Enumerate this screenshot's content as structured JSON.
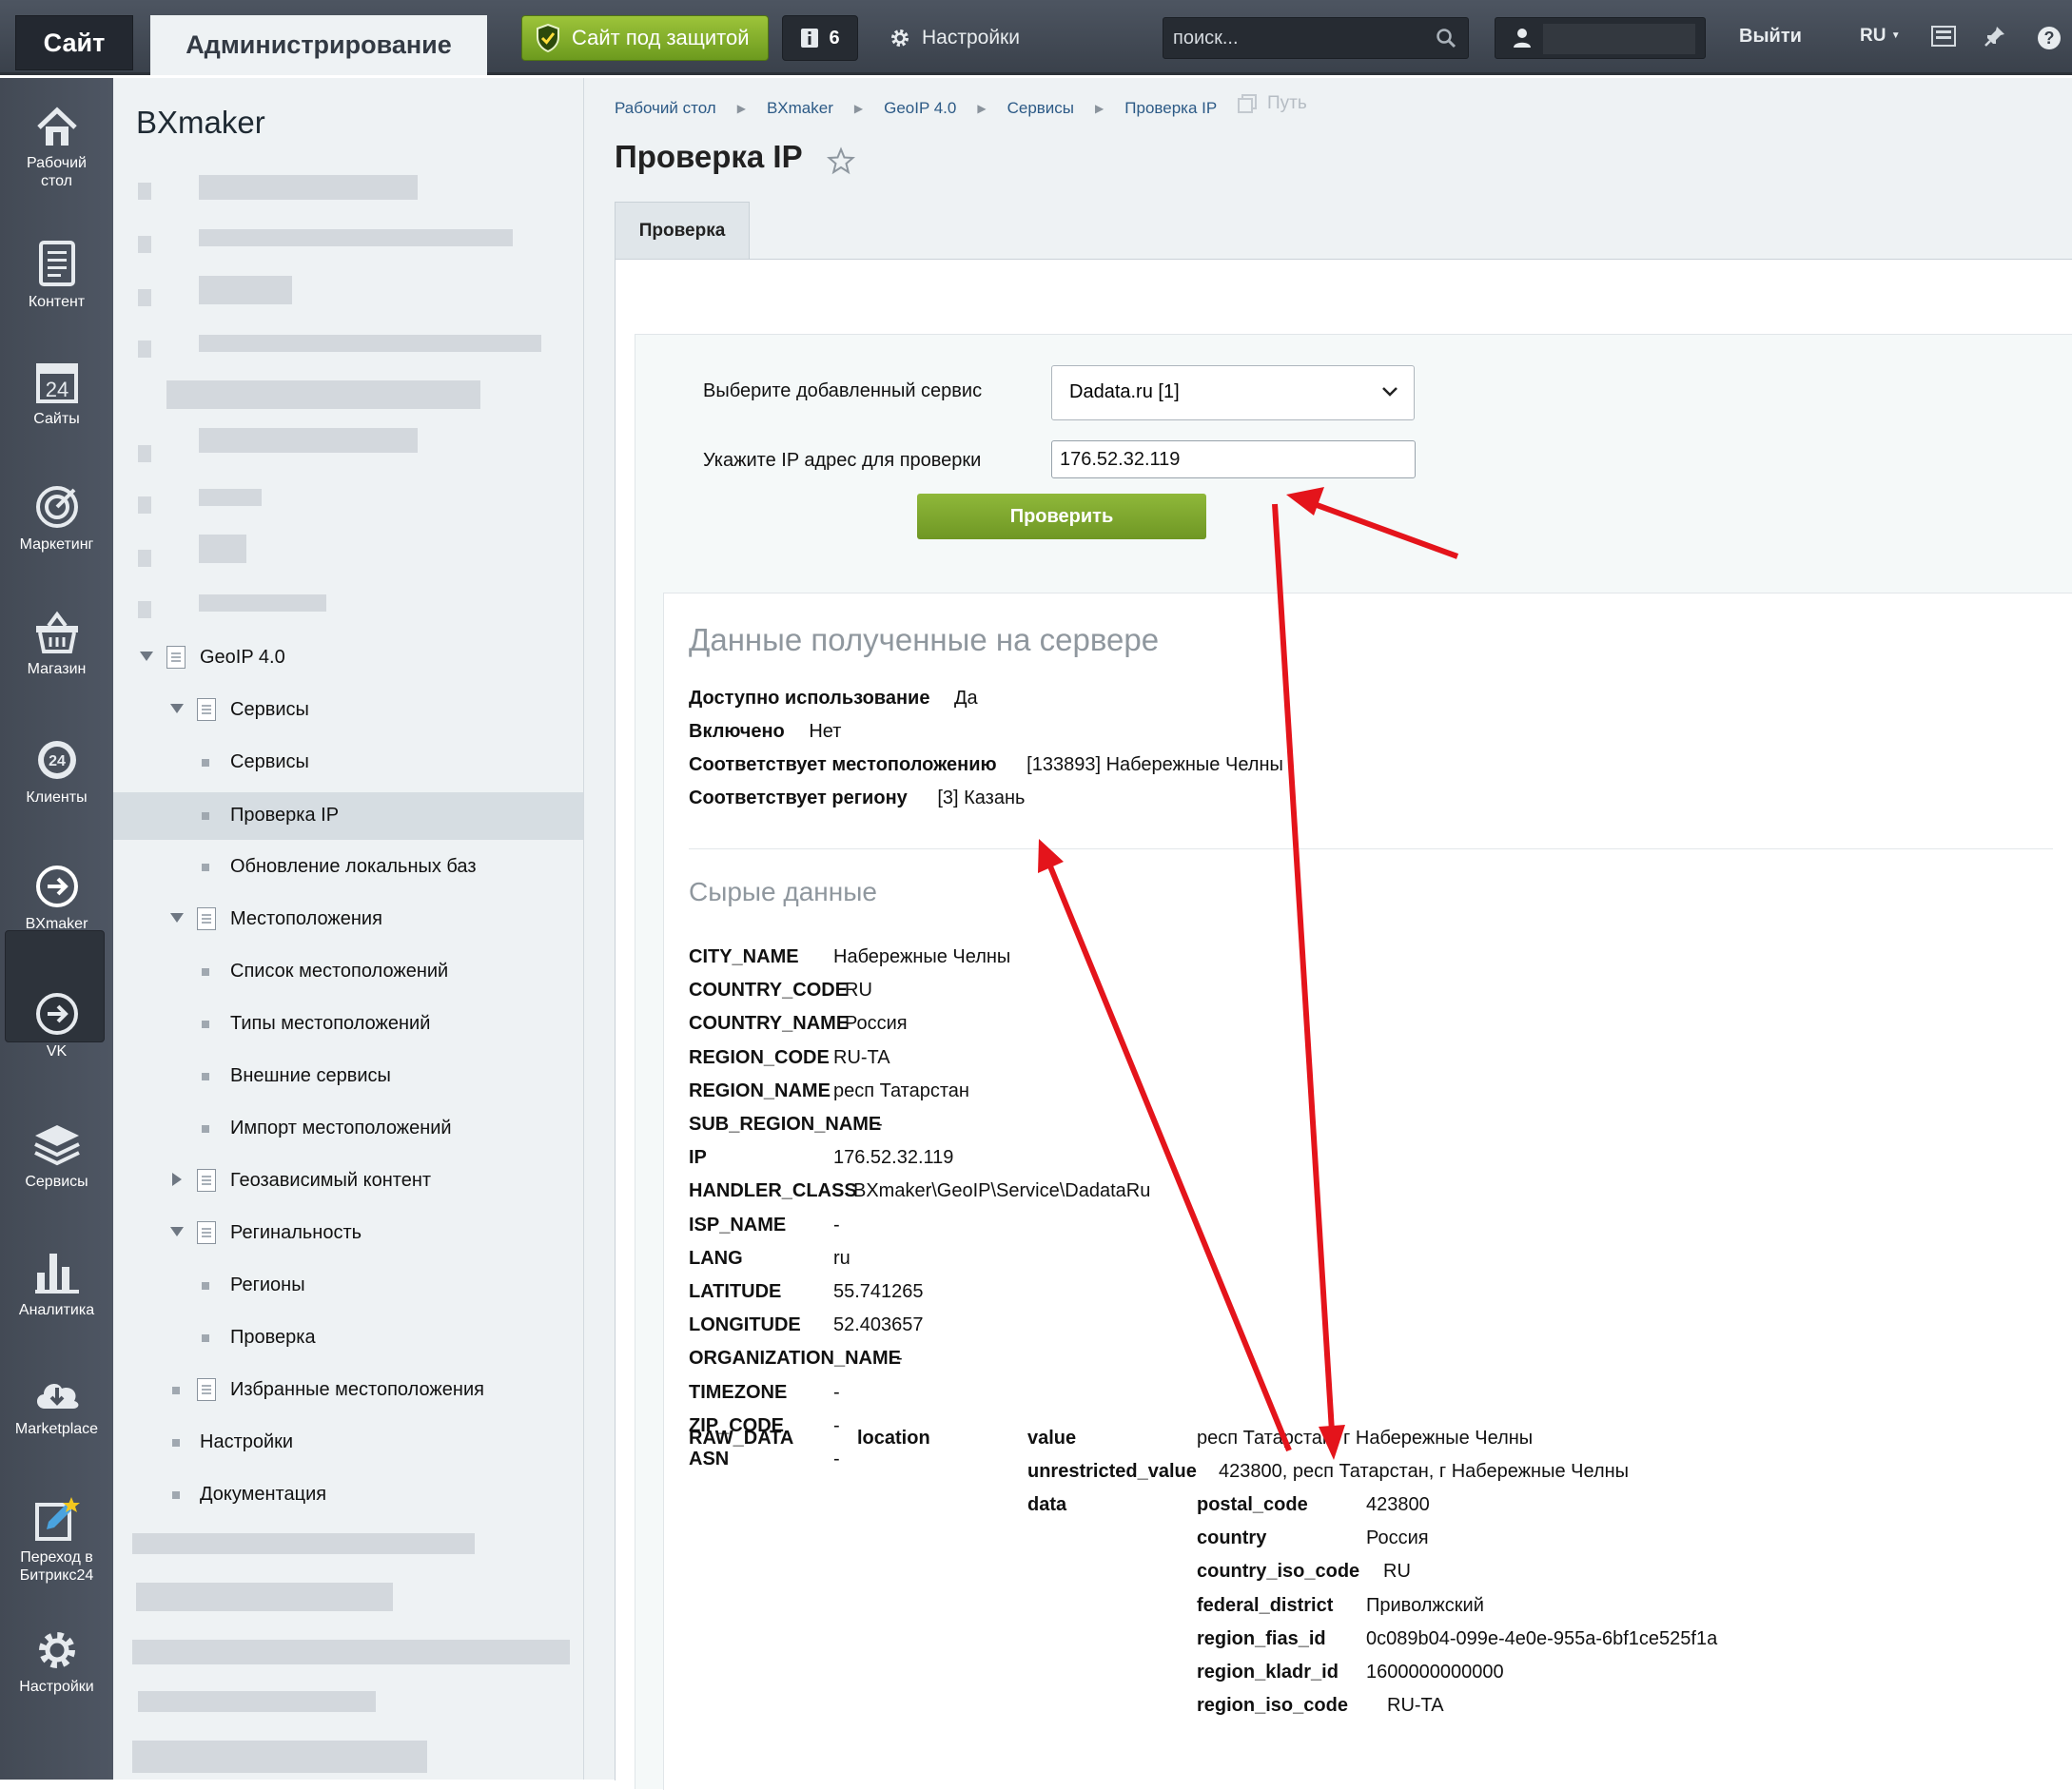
{
  "topbar": {
    "site_label": "Сайт",
    "admin_label": "Администрирование",
    "protection_label": "Сайт под защитой",
    "notifications_count": "6",
    "settings_label": "Настройки",
    "search_placeholder": "поиск...",
    "logout_label": "Выйти",
    "lang_label": "RU"
  },
  "iconbar": {
    "items": [
      {
        "label1": "Рабочий",
        "label2": "стол",
        "icon": "home-icon"
      },
      {
        "label1": "Контент",
        "label2": "",
        "icon": "document-icon"
      },
      {
        "label1": "Сайты",
        "label2": "",
        "icon": "calendar-icon"
      },
      {
        "label1": "Маркетинг",
        "label2": "",
        "icon": "target-icon"
      },
      {
        "label1": "Магазин",
        "label2": "",
        "icon": "basket-icon"
      },
      {
        "label1": "Клиенты",
        "label2": "",
        "icon": "clients-icon"
      },
      {
        "label1": "BXmaker",
        "label2": "",
        "icon": "arrow-circle-icon"
      },
      {
        "label1": "VK",
        "label2": "",
        "icon": "arrow-circle-icon"
      },
      {
        "label1": "Сервисы",
        "label2": "",
        "icon": "layers-icon"
      },
      {
        "label1": "Аналитика",
        "label2": "",
        "icon": "bar-chart-icon"
      },
      {
        "label1": "Marketplace",
        "label2": "",
        "icon": "cloud-download-icon"
      },
      {
        "label1": "Переход в",
        "label2": "Битрикс24",
        "icon": "edit-star-icon"
      },
      {
        "label1": "Настройки",
        "label2": "",
        "icon": "gear-icon"
      }
    ]
  },
  "submenu": {
    "title": "BXmaker",
    "items": [
      {
        "label": "GeoIP 4.0"
      },
      {
        "label": "Сервисы"
      },
      {
        "label": "Сервисы"
      },
      {
        "label": "Проверка IP"
      },
      {
        "label": "Обновление локальных баз"
      },
      {
        "label": "Местоположения"
      },
      {
        "label": "Список местоположений"
      },
      {
        "label": "Типы местоположений"
      },
      {
        "label": "Внешние сервисы"
      },
      {
        "label": "Импорт местоположений"
      },
      {
        "label": "Геозависимый контент"
      },
      {
        "label": "Регинальность"
      },
      {
        "label": "Регионы"
      },
      {
        "label": "Проверка"
      },
      {
        "label": "Избранные местоположения"
      },
      {
        "label": "Настройки"
      },
      {
        "label": "Документация"
      }
    ]
  },
  "breadcrumb": [
    "Рабочий стол",
    "BXmaker",
    "GeoIP 4.0",
    "Сервисы",
    "Проверка IP"
  ],
  "path_label": "Путь",
  "page_title": "Проверка IP",
  "tab_label": "Проверка",
  "form": {
    "service_label": "Выберите добавленный сервис",
    "service_value": "Dadata.ru [1]",
    "ip_label": "Укажите IP адрес для проверки",
    "ip_value": "176.52.32.119",
    "submit_label": "Проверить"
  },
  "server_data": {
    "heading": "Данные полученные на сервере",
    "rows": [
      {
        "key": "Доступно использование",
        "value": "Да"
      },
      {
        "key": "Включено",
        "value": "Нет"
      },
      {
        "key": "Соответствует местоположению",
        "value": "[133893] Набережные Челны"
      },
      {
        "key": "Соответствует региону",
        "value": "[3] Казань"
      }
    ]
  },
  "raw_data": {
    "heading": "Сырые данные",
    "rows": [
      {
        "key": "CITY_NAME",
        "value": "Набережные Челны"
      },
      {
        "key": "COUNTRY_CODE",
        "value": "RU"
      },
      {
        "key": "COUNTRY_NAME",
        "value": "Россия"
      },
      {
        "key": "REGION_CODE",
        "value": "RU-TA"
      },
      {
        "key": "REGION_NAME",
        "value": "респ Татарстан"
      },
      {
        "key": "SUB_REGION_NAME",
        "value": "-"
      },
      {
        "key": "IP",
        "value": "176.52.32.119"
      },
      {
        "key": "HANDLER_CLASS",
        "value": "BXmaker\\GeoIP\\Service\\DadataRu"
      },
      {
        "key": "ISP_NAME",
        "value": "-"
      },
      {
        "key": "LANG",
        "value": "ru"
      },
      {
        "key": "LATITUDE",
        "value": "55.741265"
      },
      {
        "key": "LONGITUDE",
        "value": "52.403657"
      },
      {
        "key": "ORGANIZATION_NAME",
        "value": "-"
      },
      {
        "key": "TIMEZONE",
        "value": "-"
      },
      {
        "key": "ZIP_CODE",
        "value": "-"
      },
      {
        "key": "ASN",
        "value": "-"
      }
    ],
    "raw_key": "RAW_DATA",
    "location_key": "location",
    "nested": [
      {
        "key": "value",
        "value": "респ Татарстан, г Набережные Челны"
      },
      {
        "key": "unrestricted_value",
        "value": "423800, респ Татарстан, г Набережные Челны"
      }
    ],
    "data_key": "data",
    "data_rows": [
      {
        "key": "postal_code",
        "value": "423800"
      },
      {
        "key": "country",
        "value": "Россия"
      },
      {
        "key": "country_iso_code",
        "value": "RU"
      },
      {
        "key": "federal_district",
        "value": "Приволжский"
      },
      {
        "key": "region_fias_id",
        "value": "0c089b04-099e-4e0e-955a-6bf1ce525f1a"
      },
      {
        "key": "region_kladr_id",
        "value": "1600000000000"
      },
      {
        "key": "region_iso_code",
        "value": "RU-TA"
      }
    ]
  },
  "colors": {
    "accent_green": "#7da52c",
    "annotation_red": "#e4141b",
    "link_blue": "#2c5a86"
  }
}
